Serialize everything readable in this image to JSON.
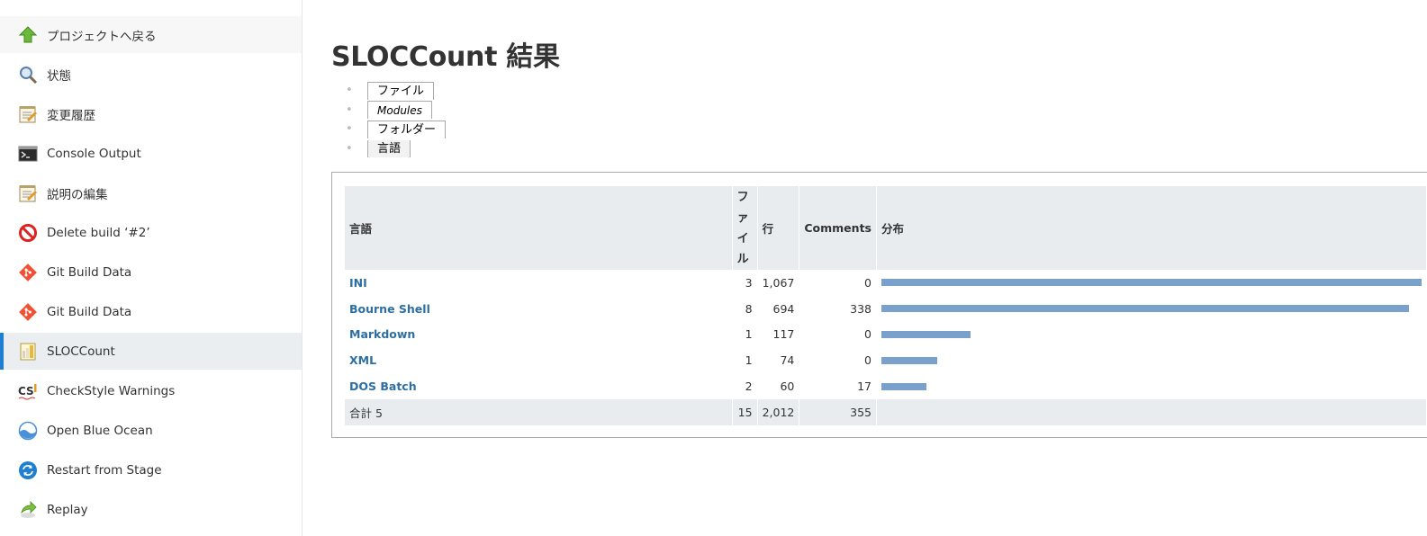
{
  "sidebar": {
    "items": [
      {
        "label": "プロジェクトへ戻る",
        "icon": "up-arrow-icon"
      },
      {
        "label": "状態",
        "icon": "magnifier-icon"
      },
      {
        "label": "変更履歴",
        "icon": "notepad-icon"
      },
      {
        "label": "Console Output",
        "icon": "terminal-icon"
      },
      {
        "label": "説明の編集",
        "icon": "notepad-icon"
      },
      {
        "label": "Delete build ‘#2’",
        "icon": "no-entry-icon"
      },
      {
        "label": "Git Build Data",
        "icon": "git-icon"
      },
      {
        "label": "Git Build Data",
        "icon": "git-icon"
      },
      {
        "label": "SLOCCount",
        "icon": "sloccount-icon"
      },
      {
        "label": "CheckStyle Warnings",
        "icon": "checkstyle-icon"
      },
      {
        "label": "Open Blue Ocean",
        "icon": "blue-ocean-icon"
      },
      {
        "label": "Restart from Stage",
        "icon": "restart-icon"
      },
      {
        "label": "Replay",
        "icon": "replay-icon"
      }
    ]
  },
  "main": {
    "title": "SLOCCount 結果",
    "tabs": [
      "ファイル",
      "Modules",
      "フォルダー",
      "言語"
    ],
    "selected_tab": "言語"
  },
  "table": {
    "headers": {
      "language": "言語",
      "files_chars": [
        "フ",
        "ァ",
        "イ",
        "ル"
      ],
      "lines": "行",
      "comments": "Comments",
      "distribution": "分布"
    },
    "rows": [
      {
        "language": "INI",
        "files": "3",
        "lines": "1,067",
        "comments": "0",
        "share": 1.0
      },
      {
        "language": "Bourne Shell",
        "files": "8",
        "lines": "694",
        "comments": "338",
        "share": 0.976
      },
      {
        "language": "Markdown",
        "files": "1",
        "lines": "117",
        "comments": "0",
        "share": 0.165
      },
      {
        "language": "XML",
        "files": "1",
        "lines": "74",
        "comments": "0",
        "share": 0.104
      },
      {
        "language": "DOS Batch",
        "files": "2",
        "lines": "60",
        "comments": "17",
        "share": 0.084
      }
    ],
    "total": {
      "label": "合計 5",
      "files": "15",
      "lines": "2,012",
      "comments": "355"
    }
  },
  "colors": {
    "accent": "#1f7fd1",
    "link": "#2e6fa3",
    "bar": "#7aa0cc",
    "header_bg": "#e8ecef"
  }
}
